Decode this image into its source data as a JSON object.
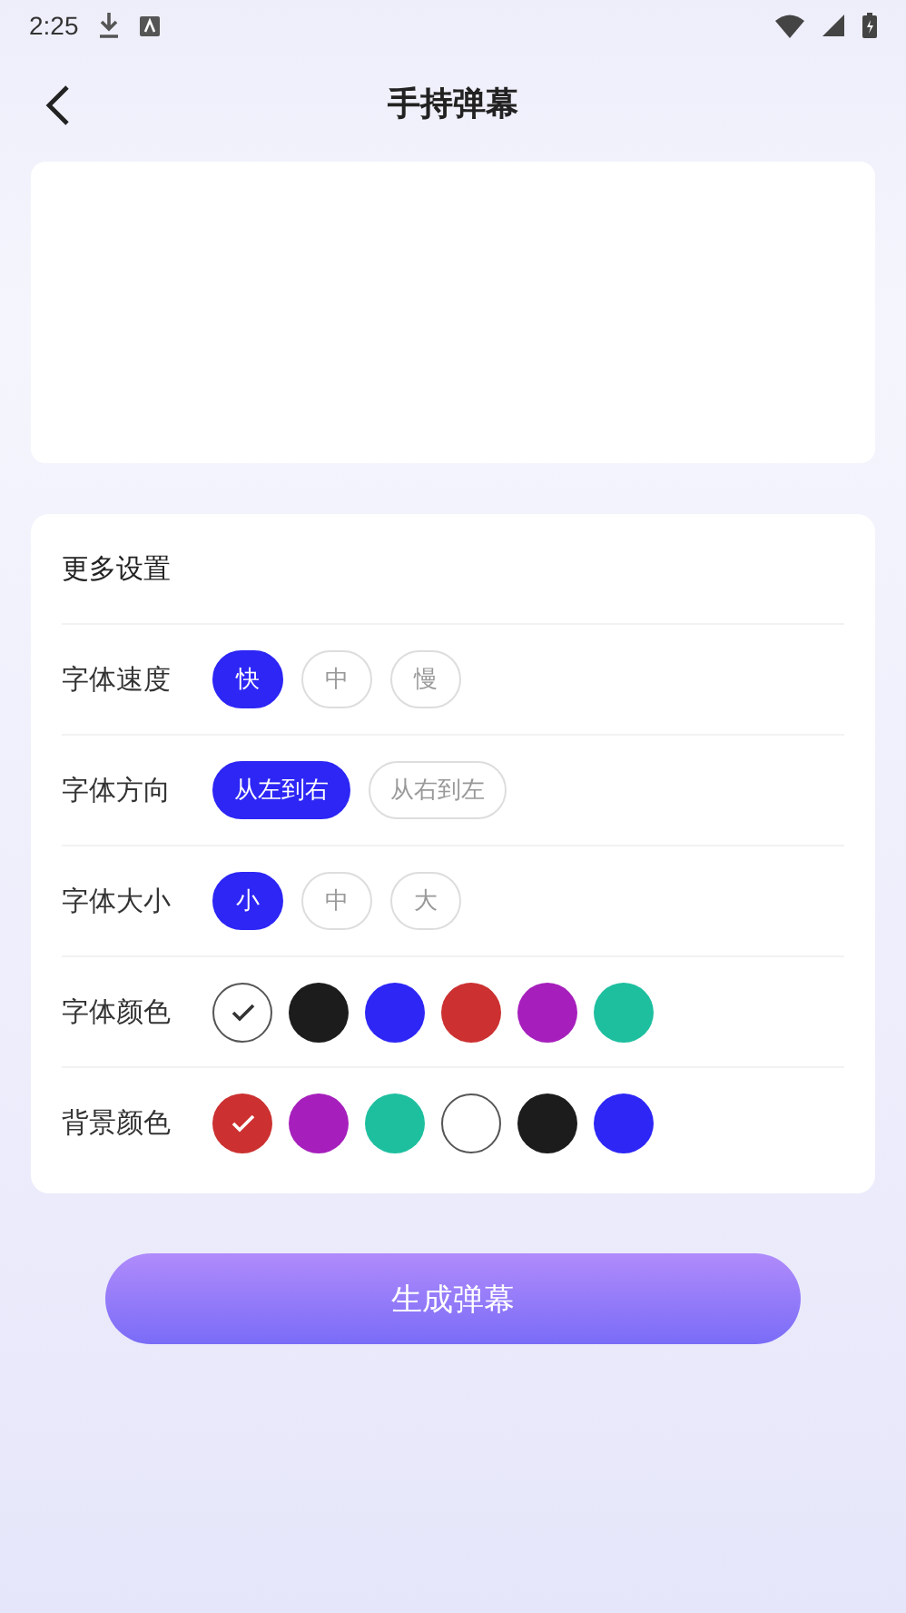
{
  "status_bar": {
    "time": "2:25"
  },
  "header": {
    "title": "手持弹幕"
  },
  "settings": {
    "title": "更多设置",
    "rows": [
      {
        "label": "字体速度",
        "kind": "chip",
        "options": [
          {
            "label": "快",
            "selected": true
          },
          {
            "label": "中",
            "selected": false
          },
          {
            "label": "慢",
            "selected": false
          }
        ]
      },
      {
        "label": "字体方向",
        "kind": "chip",
        "options": [
          {
            "label": "从左到右",
            "selected": true
          },
          {
            "label": "从右到左",
            "selected": false
          }
        ]
      },
      {
        "label": "字体大小",
        "kind": "chip",
        "options": [
          {
            "label": "小",
            "selected": true
          },
          {
            "label": "中",
            "selected": false
          },
          {
            "label": "大",
            "selected": false
          }
        ]
      },
      {
        "label": "字体颜色",
        "kind": "swatch",
        "options": [
          {
            "color": "#ffffff",
            "selected": true
          },
          {
            "color": "#1c1c1c",
            "selected": false
          },
          {
            "color": "#2d26f5",
            "selected": false
          },
          {
            "color": "#cc3030",
            "selected": false
          },
          {
            "color": "#a61fbc",
            "selected": false
          },
          {
            "color": "#1dbf9f",
            "selected": false
          }
        ]
      },
      {
        "label": "背景颜色",
        "kind": "swatch",
        "options": [
          {
            "color": "#cc3030",
            "selected": true
          },
          {
            "color": "#a61fbc",
            "selected": false
          },
          {
            "color": "#1dbf9f",
            "selected": false
          },
          {
            "color": "#ffffff",
            "selected": false
          },
          {
            "color": "#1c1c1c",
            "selected": false
          },
          {
            "color": "#2d26f5",
            "selected": false
          }
        ]
      }
    ]
  },
  "generate_button": {
    "label": "生成弹幕"
  }
}
